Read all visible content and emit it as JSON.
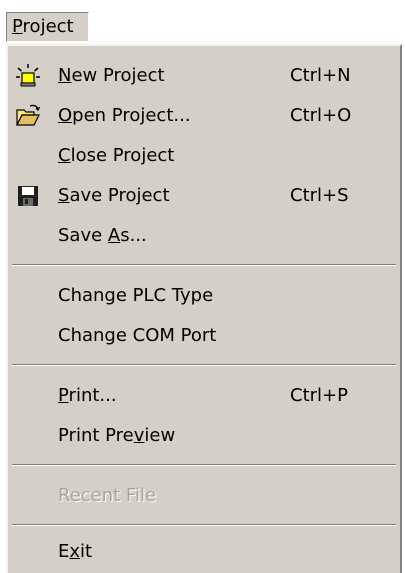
{
  "menubar": {
    "label_u": "P",
    "label_rest": "roject"
  },
  "menu": {
    "new_project": {
      "pre": "",
      "u": "N",
      "post": "ew Project",
      "shortcut": "Ctrl+N",
      "icon": "new-project-icon"
    },
    "open_project": {
      "pre": "",
      "u": "O",
      "post": "pen Project...",
      "shortcut": "Ctrl+O",
      "icon": "open-folder-icon"
    },
    "close_project": {
      "pre": "",
      "u": "C",
      "post": "lose Project"
    },
    "save_project": {
      "pre": "",
      "u": "S",
      "post": "ave Project",
      "shortcut": "Ctrl+S",
      "icon": "floppy-disk-icon"
    },
    "save_as": {
      "pre": "Save ",
      "u": "A",
      "post": "s..."
    },
    "change_plc_type": {
      "label": "Change PLC Type"
    },
    "change_com_port": {
      "label": "Change COM Port"
    },
    "print": {
      "pre": "",
      "u": "P",
      "post": "rint...",
      "shortcut": "Ctrl+P"
    },
    "print_preview": {
      "pre": "Print Pre",
      "u": "v",
      "post": "iew"
    },
    "recent_file": {
      "label": "Recent File",
      "enabled": false
    },
    "exit": {
      "pre": "E",
      "u": "x",
      "post": "it"
    }
  },
  "colors": {
    "menu_face": "#d4d0c8",
    "disabled_text": "#a7a49d",
    "icon_yellow": "#ffff00",
    "floppy_dark": "#1f1f1f"
  }
}
